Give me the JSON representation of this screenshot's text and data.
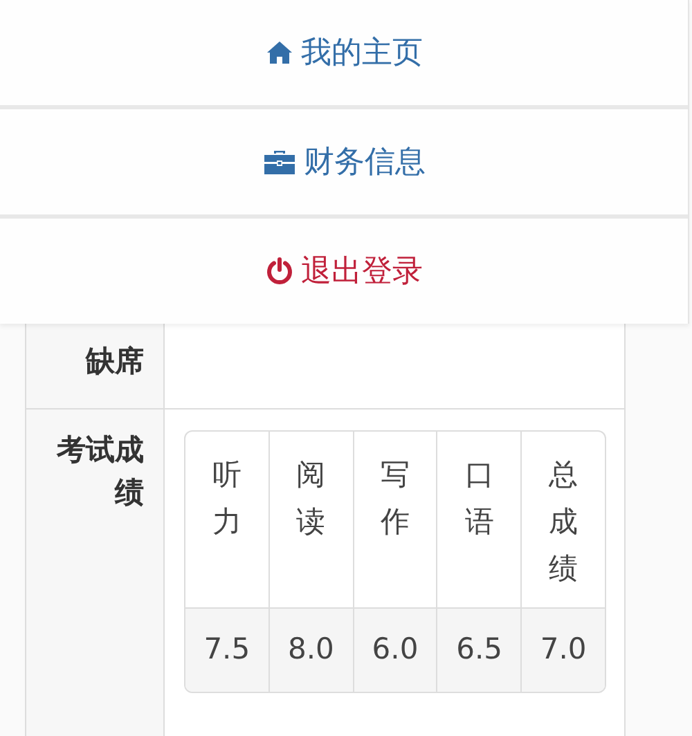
{
  "menu": [
    {
      "kind": "home",
      "label": "我的主页",
      "color": "#336ea8"
    },
    {
      "kind": "briefcase",
      "label": "财务信息",
      "color": "#336ea8"
    },
    {
      "kind": "power",
      "label": "退出登录",
      "color": "#c0203a"
    }
  ],
  "table": {
    "rows": [
      {
        "label": "缺席"
      },
      {
        "label": "考试成绩",
        "scores": {
          "columns": [
            "听力",
            "阅读",
            "写作",
            "口语",
            "总成绩"
          ],
          "values": [
            "7.5",
            "8.0",
            "6.0",
            "6.5",
            "7.0"
          ]
        }
      }
    ]
  }
}
